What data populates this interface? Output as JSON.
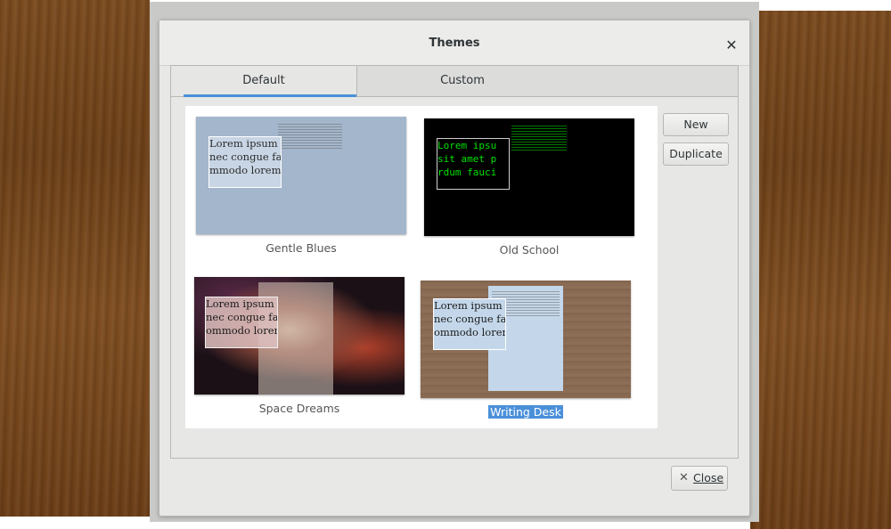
{
  "window": {
    "title": "Themes",
    "close_icon": "close-icon",
    "tabs": [
      {
        "label": "Default",
        "selected": true
      },
      {
        "label": "Custom",
        "selected": false
      }
    ]
  },
  "themes": [
    {
      "name": "Gentle Blues",
      "sample_text": "Lorem ipsum\nnec congue faci\nmmodo lorem.",
      "selected": false
    },
    {
      "name": "Old School",
      "sample_text": "Lorem ipsu\nsit amet p\nrdum fauci",
      "selected": false
    },
    {
      "name": "Space Dreams",
      "sample_text": "Lorem ipsum\nnec congue fac\nommodo lorem.",
      "selected": false
    },
    {
      "name": "Writing Desk",
      "sample_text": "Lorem ipsum\nnec congue fac\nommodo lorem.",
      "selected": true
    }
  ],
  "buttons": {
    "new_label": "New",
    "duplicate_label": "Duplicate",
    "close_label": "Close",
    "close_icon": "close-x-icon"
  },
  "colors": {
    "accent": "#4a90d9",
    "wood": "#7a4a1e",
    "gentle_blues_bg": "#a3b6cc",
    "old_school_bg": "#000000",
    "old_school_text": "#00e000"
  }
}
